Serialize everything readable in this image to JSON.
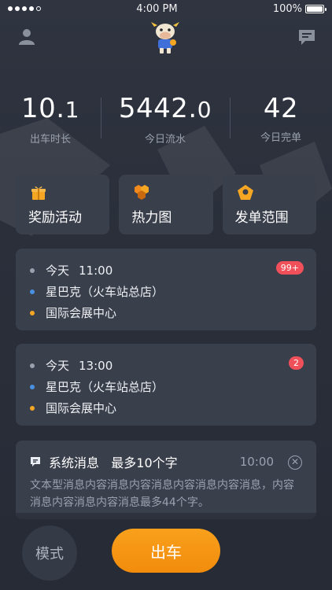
{
  "status_bar": {
    "time": "4:00 PM",
    "battery": "100%"
  },
  "stats": {
    "duration_int": "10.",
    "duration_dec": "1",
    "duration_label": "出车时长",
    "income_int": "5442.",
    "income_dec": "0",
    "income_label": "今日流水",
    "orders": "42",
    "orders_label": "今日完单"
  },
  "actions": [
    {
      "label": "奖励活动",
      "icon": "gift-icon"
    },
    {
      "label": "热力图",
      "icon": "heatmap-icon"
    },
    {
      "label": "发单范围",
      "icon": "range-icon"
    }
  ],
  "orders": [
    {
      "time": "今天",
      "clock": "11:00",
      "from": "星巴克（火车站总店）",
      "to": "国际会展中心",
      "badge": "99+"
    },
    {
      "time": "今天",
      "clock": "13:00",
      "from": "星巴克（火车站总店）",
      "to": "国际会展中心",
      "badge": "2"
    }
  ],
  "message": {
    "title": "系统消息   最多10个字",
    "time": "10:00",
    "body": "文本型消息内容消息内容消息内容消息内容消息，内容消息内容消息内容消息最多44个字。"
  },
  "bottom": {
    "mode_label": "模式",
    "go_label": "出车"
  },
  "colors": {
    "background": "#2a2f3b",
    "card": "#3a3f4c",
    "accent": "#f5a623",
    "badge": "#f0505a"
  }
}
